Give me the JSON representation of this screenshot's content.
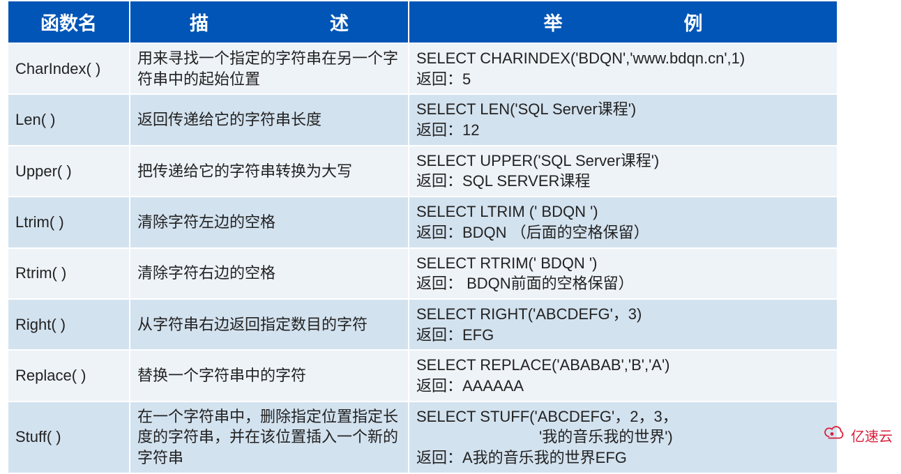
{
  "headers": {
    "col1": "函数名",
    "col2": "描　　述",
    "col3": "举　　例"
  },
  "rows": [
    {
      "name": "CharIndex( )",
      "desc": "用来寻找一个指定的字符串在另一个字符串中的起始位置",
      "example1": "SELECT CHARINDEX('BDQN','www.bdqn.cn',1)",
      "example2": "返回：5"
    },
    {
      "name": "Len( )",
      "desc": "返回传递给它的字符串长度",
      "example1": "SELECT LEN('SQL Server课程')",
      "example2": "返回：12"
    },
    {
      "name": "Upper( )",
      "desc": "把传递给它的字符串转换为大写",
      "example1": "SELECT UPPER('SQL Server课程')",
      "example2": "返回：SQL SERVER课程"
    },
    {
      "name": "Ltrim( )",
      "desc": "清除字符左边的空格",
      "example1": "SELECT LTRIM ('  BDQN  ')",
      "example2": "返回：BDQN  （后面的空格保留）"
    },
    {
      "name": "Rtrim( )",
      "desc": "清除字符右边的空格",
      "example1": "SELECT RTRIM('  BDQN  ')",
      "example2": "返回：  BDQN前面的空格保留）"
    },
    {
      "name": "Right( )",
      "desc": "从字符串右边返回指定数目的字符",
      "example1": "SELECT RIGHT('ABCDEFG'，3)",
      "example2": "返回：EFG"
    },
    {
      "name": "Replace( )",
      "desc": "替换一个字符串中的字符",
      "example1": "SELECT REPLACE('ABABAB','B','A')",
      "example2": "返回：AAAAAA"
    },
    {
      "name": "Stuff( )",
      "desc": "在一个字符串中，删除指定位置指定长度的字符串，并在该位置插入一个新的字符串",
      "example1": "SELECT STUFF('ABCDEFG'，2，3，",
      "example2": "　　　　　　　　'我的音乐我的世界')",
      "example3": "返回：A我的音乐我的世界EFG"
    }
  ],
  "watermark": "亿速云"
}
